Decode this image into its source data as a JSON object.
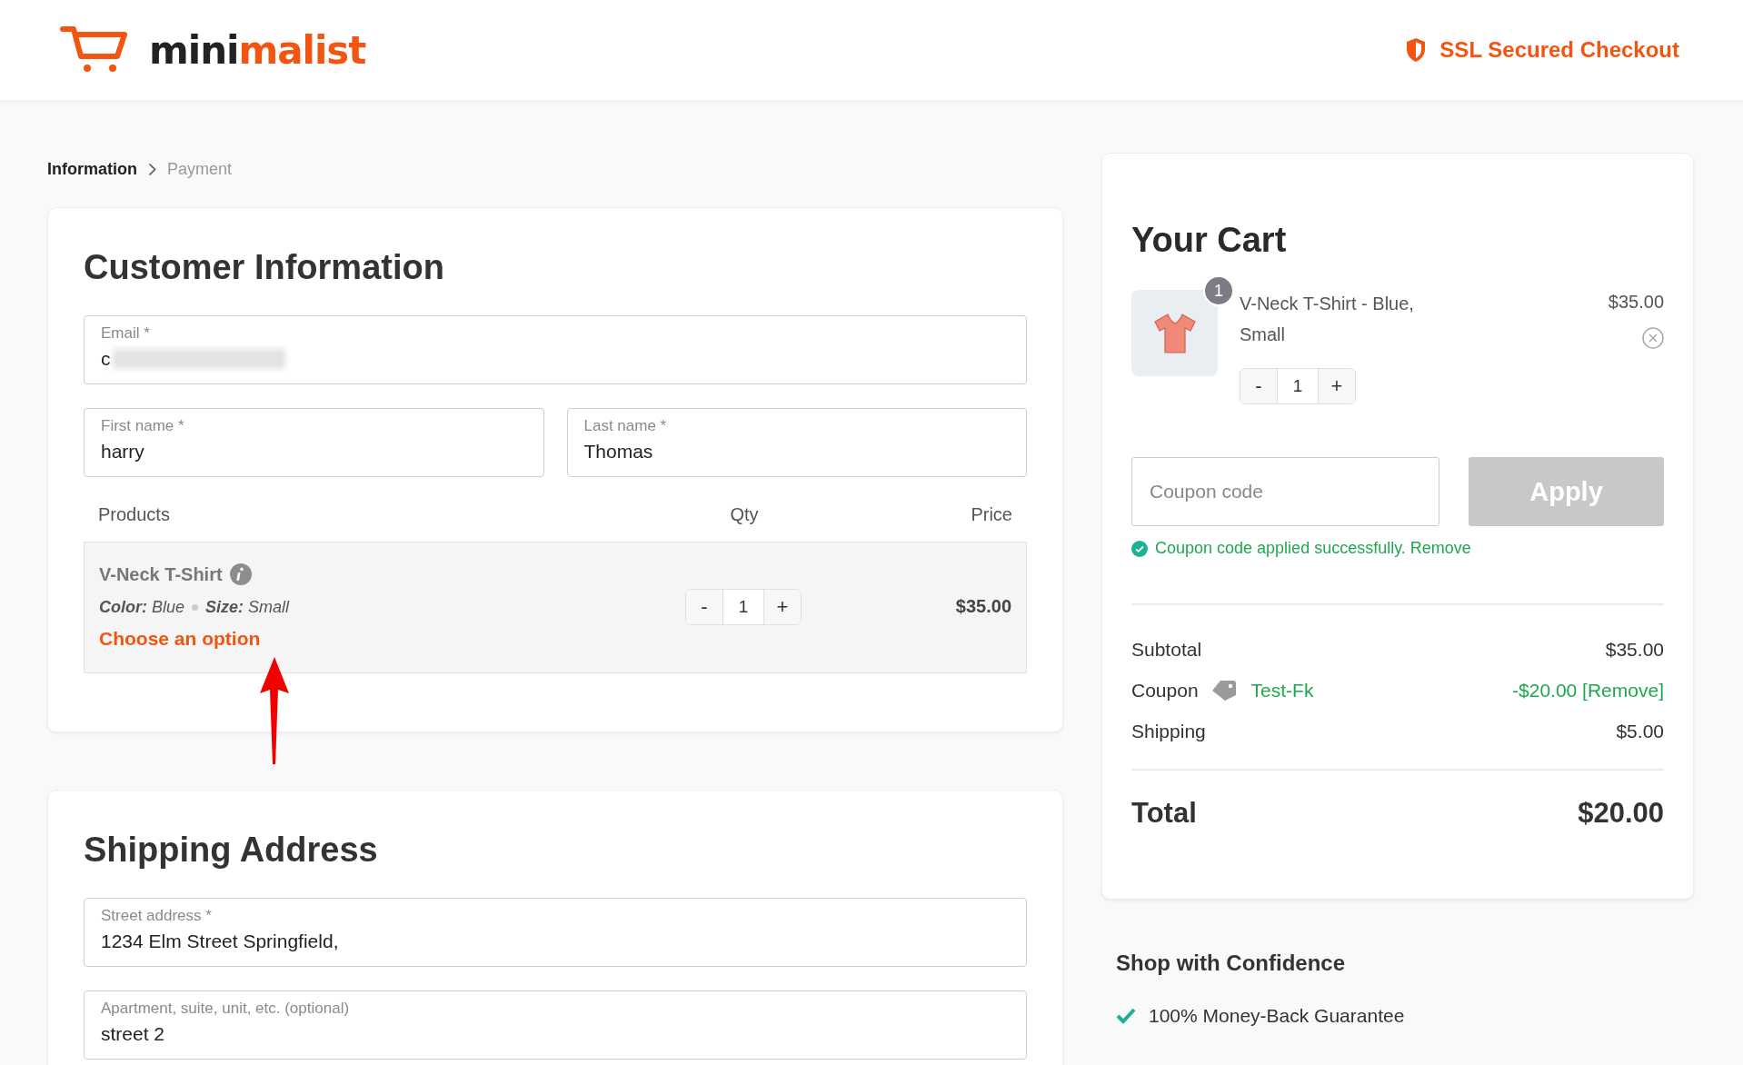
{
  "header": {
    "logo": {
      "part_1": "mini",
      "part_2": "malist"
    },
    "secure_label": "SSL Secured Checkout"
  },
  "breadcrumb": [
    {
      "label": "Information",
      "selected": true
    },
    {
      "label": "Payment",
      "selected": false
    }
  ],
  "customer_information": {
    "title": "Customer Information",
    "fields": [
      {
        "label": "Email *",
        "value": "c",
        "redacted": true
      },
      {
        "label": "First name *",
        "value": "harry",
        "redacted": false
      },
      {
        "label": "Last name *",
        "value": "Thomas",
        "redacted": false
      }
    ],
    "products": {
      "columns": [
        "Products",
        "Qty",
        "Price"
      ],
      "rows": [
        {
          "name": "V-Neck T-Shirt",
          "attributes": [
            "**Color:** Blue",
            "**Size:** Small"
          ],
          "option_prompt": "Choose an option",
          "quantity": {
            "decrement": "-",
            "value": "1",
            "increment": "+"
          },
          "price": "$35.00"
        }
      ]
    }
  },
  "shipping_address": {
    "title": "Shipping Address",
    "fields": [
      {
        "label": "Street address *",
        "value": "1234 Elm Street Springfield,",
        "redacted": false
      },
      {
        "label": "Apartment, suite, unit, etc. (optional)",
        "value": "street 2",
        "redacted": false
      }
    ]
  },
  "cart": {
    "title": "Your Cart",
    "items": [
      {
        "count": "1",
        "name": "V-Neck T-Shirt - Blue, Small",
        "price": "$35.00",
        "quantity": {
          "decrement": "-",
          "value": "1",
          "increment": "+"
        }
      }
    ],
    "coupon": {
      "placeholder": "Coupon code",
      "button": "Apply",
      "disabled": true,
      "message": "Coupon code applied successfully.",
      "message_link": "Remove"
    },
    "summary": [
      {
        "kind": "plain",
        "label": "Subtotal",
        "value": "$35.00"
      },
      {
        "kind": "coupon",
        "label": "Coupon",
        "code": "Test-Fk",
        "value": "-$20.00 [Remove]"
      },
      {
        "kind": "plain",
        "label": "Shipping",
        "value": "$5.00"
      },
      {
        "kind": "total",
        "label": "Total",
        "value": "$20.00"
      }
    ]
  },
  "confidence": {
    "title": "Shop with Confidence",
    "items": [
      "100% Money-Back Guarantee"
    ]
  }
}
